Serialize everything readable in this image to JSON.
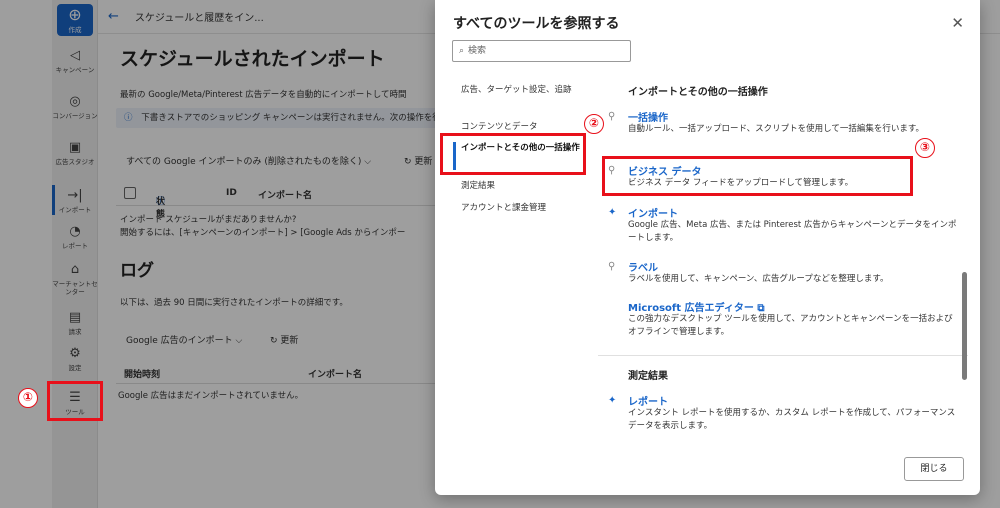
{
  "rail": {
    "create": "作成",
    "items": [
      "キャンペーン",
      "コンバージョン",
      "広告スタジオ",
      "インポート",
      "レポート",
      "マーチャントセンター",
      "請求",
      "設定",
      "ツール"
    ]
  },
  "page": {
    "breadcrumb": "スケジュールと履歴をイン...",
    "title": "スケジュールされたインポート",
    "description": "最新の Google/Meta/Pinterest 広告データを自動的にインポートして時間",
    "info": "下書きストアでのショッピング キャンペーンは実行されません。次の操作を行",
    "filter": "すべての Google インポートのみ (削除されたものを除く)",
    "refresh": "更新",
    "columns": [
      "状態",
      "ID",
      "インポート名"
    ],
    "empty_line1": "インポート スケジュールがまだありませんか?",
    "empty_line2": "開始するには、[キャンペーンのインポート] > [Google Ads からインポー",
    "log_title": "ログ",
    "log_description": "以下は、過去 90 日間に実行されたインポートの詳細です。",
    "log_filter": "Google 広告のインポート",
    "log_refresh": "更新",
    "log_columns": [
      "開始時刻",
      "インポート名"
    ],
    "log_empty": "Google 広告はまだインポートされていません。"
  },
  "dialog": {
    "title": "すべてのツールを参照する",
    "search_placeholder": "検索",
    "nav": [
      "広告、ターゲット設定、追跡",
      "コンテンツとデータ",
      "インポートとその他の一括操作",
      "測定結果",
      "アカウントと課金管理"
    ],
    "section1": "インポートとその他の一括操作",
    "tools": [
      {
        "name": "一括操作",
        "desc": "自動ルール、一括アップロード、スクリプトを使用して一括編集を行います。"
      },
      {
        "name": "ビジネス データ",
        "desc": "ビジネス データ フィードをアップロードして管理します。"
      },
      {
        "name": "インポート",
        "desc": "Google 広告、Meta 広告、または Pinterest 広告からキャンペーンとデータをインポートします。"
      },
      {
        "name": "ラベル",
        "desc": "ラベルを使用して、キャンペーン、広告グループなどを整理します。"
      },
      {
        "name": "Microsoft 広告エディター",
        "desc": "この強力なデスクトップ ツールを使用して、アカウントとキャンペーンを一括およびオフラインで管理します。"
      }
    ],
    "section2": "測定結果",
    "tools2": [
      {
        "name": "レポート",
        "desc": "インスタント レポートを使用するか、カスタム レポートを作成して、パフォーマンス データを表示します。"
      }
    ],
    "close": "閉じる"
  },
  "annotations": [
    "①",
    "②",
    "③"
  ]
}
